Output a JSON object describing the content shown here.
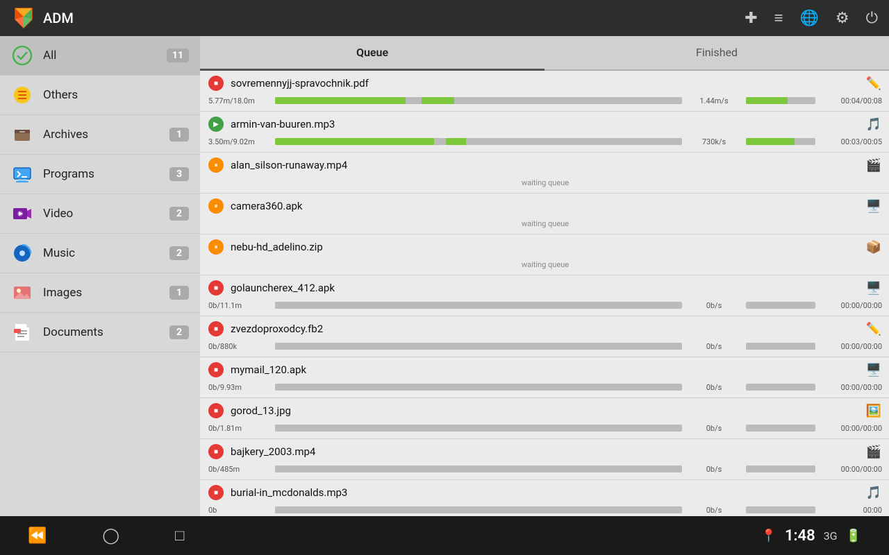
{
  "app": {
    "title": "ADM"
  },
  "topbar": {
    "actions": [
      "add",
      "menu",
      "globe",
      "equalizer",
      "power"
    ]
  },
  "sidebar": {
    "items": [
      {
        "id": "all",
        "label": "All",
        "badge": "11",
        "icon": "all"
      },
      {
        "id": "others",
        "label": "Others",
        "badge": null,
        "icon": "others"
      },
      {
        "id": "archives",
        "label": "Archives",
        "badge": "1",
        "icon": "archives"
      },
      {
        "id": "programs",
        "label": "Programs",
        "badge": "3",
        "icon": "programs"
      },
      {
        "id": "video",
        "label": "Video",
        "badge": "2",
        "icon": "video"
      },
      {
        "id": "music",
        "label": "Music",
        "badge": "2",
        "icon": "music"
      },
      {
        "id": "images",
        "label": "Images",
        "badge": "1",
        "icon": "images"
      },
      {
        "id": "documents",
        "label": "Documents",
        "badge": "2",
        "icon": "documents"
      }
    ]
  },
  "tabs": [
    {
      "id": "queue",
      "label": "Queue",
      "active": true
    },
    {
      "id": "finished",
      "label": "Finished",
      "active": false
    }
  ],
  "downloads": [
    {
      "id": 1,
      "filename": "sovremennyjj-spravochnik.pdf",
      "status": "downloading",
      "status_color": "red",
      "size_progress": "5.77m/18.0m",
      "speed": "1.44m/s",
      "time": "00:04/00:08",
      "progress_pct": 32,
      "progress_pct2": 60,
      "has_progress": true,
      "file_type_icon": "✏️"
    },
    {
      "id": 2,
      "filename": "armin-van-buuren.mp3",
      "status": "downloading",
      "status_color": "green",
      "size_progress": "3.50m/9.02m",
      "speed": "730k/s",
      "time": "00:03/00:05",
      "progress_pct": 39,
      "progress_pct2": 70,
      "has_progress": true,
      "file_type_icon": "🎵"
    },
    {
      "id": 3,
      "filename": "alan_silson-runaway.mp4",
      "status": "paused",
      "status_color": "orange",
      "waiting": "waiting queue",
      "has_progress": false,
      "file_type_icon": "🎬"
    },
    {
      "id": 4,
      "filename": "camera360.apk",
      "status": "paused",
      "status_color": "orange",
      "waiting": "waiting queue",
      "has_progress": false,
      "file_type_icon": "🖥️"
    },
    {
      "id": 5,
      "filename": "nebu-hd_adelino.zip",
      "status": "paused",
      "status_color": "orange",
      "waiting": "waiting queue",
      "has_progress": false,
      "file_type_icon": "📦"
    },
    {
      "id": 6,
      "filename": "golauncherex_412.apk",
      "status": "error",
      "status_color": "red",
      "size_progress": "0b/11.1m",
      "speed": "0b/s",
      "time": "00:00/00:00",
      "progress_pct": 0,
      "has_progress": true,
      "file_type_icon": "🖥️"
    },
    {
      "id": 7,
      "filename": "zvezdoproxodcy.fb2",
      "status": "error",
      "status_color": "red",
      "size_progress": "0b/880k",
      "speed": "0b/s",
      "time": "00:00/00:00",
      "progress_pct": 0,
      "has_progress": true,
      "file_type_icon": "✏️"
    },
    {
      "id": 8,
      "filename": "mymail_120.apk",
      "status": "error",
      "status_color": "red",
      "size_progress": "0b/9.93m",
      "speed": "0b/s",
      "time": "00:00/00:00",
      "progress_pct": 0,
      "has_progress": true,
      "file_type_icon": "🖥️"
    },
    {
      "id": 9,
      "filename": "gorod_13.jpg",
      "status": "error",
      "status_color": "red",
      "size_progress": "0b/1.81m",
      "speed": "0b/s",
      "time": "00:00/00:00",
      "progress_pct": 0,
      "has_progress": true,
      "file_type_icon": "🖼️"
    },
    {
      "id": 10,
      "filename": "bajkery_2003.mp4",
      "status": "error",
      "status_color": "red",
      "size_progress": "0b/485m",
      "speed": "0b/s",
      "time": "00:00/00:00",
      "progress_pct": 0,
      "has_progress": true,
      "file_type_icon": "🎬"
    },
    {
      "id": 11,
      "filename": "burial-in_mcdonalds.mp3",
      "status": "error",
      "status_color": "red",
      "size_progress": "0b",
      "speed": "0b/s",
      "time": "00:00",
      "progress_pct": 0,
      "has_progress": true,
      "file_type_icon": "🎵"
    }
  ],
  "bottombar": {
    "time": "1:48",
    "signal": "3G",
    "battery": "⚡"
  }
}
